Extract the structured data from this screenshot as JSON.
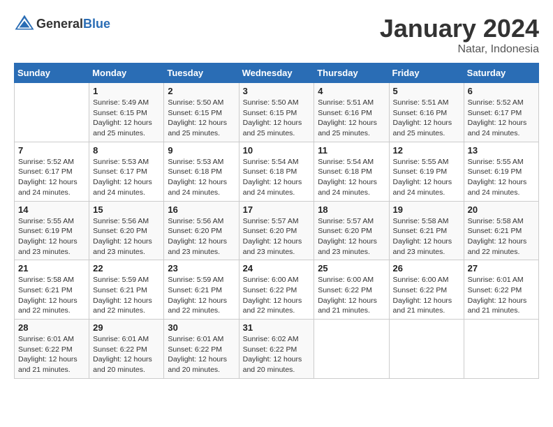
{
  "logo": {
    "text_general": "General",
    "text_blue": "Blue"
  },
  "title": "January 2024",
  "location": "Natar, Indonesia",
  "days_of_week": [
    "Sunday",
    "Monday",
    "Tuesday",
    "Wednesday",
    "Thursday",
    "Friday",
    "Saturday"
  ],
  "weeks": [
    [
      {
        "num": "",
        "info": ""
      },
      {
        "num": "1",
        "info": "Sunrise: 5:49 AM\nSunset: 6:15 PM\nDaylight: 12 hours\nand 25 minutes."
      },
      {
        "num": "2",
        "info": "Sunrise: 5:50 AM\nSunset: 6:15 PM\nDaylight: 12 hours\nand 25 minutes."
      },
      {
        "num": "3",
        "info": "Sunrise: 5:50 AM\nSunset: 6:15 PM\nDaylight: 12 hours\nand 25 minutes."
      },
      {
        "num": "4",
        "info": "Sunrise: 5:51 AM\nSunset: 6:16 PM\nDaylight: 12 hours\nand 25 minutes."
      },
      {
        "num": "5",
        "info": "Sunrise: 5:51 AM\nSunset: 6:16 PM\nDaylight: 12 hours\nand 25 minutes."
      },
      {
        "num": "6",
        "info": "Sunrise: 5:52 AM\nSunset: 6:17 PM\nDaylight: 12 hours\nand 24 minutes."
      }
    ],
    [
      {
        "num": "7",
        "info": "Sunrise: 5:52 AM\nSunset: 6:17 PM\nDaylight: 12 hours\nand 24 minutes."
      },
      {
        "num": "8",
        "info": "Sunrise: 5:53 AM\nSunset: 6:17 PM\nDaylight: 12 hours\nand 24 minutes."
      },
      {
        "num": "9",
        "info": "Sunrise: 5:53 AM\nSunset: 6:18 PM\nDaylight: 12 hours\nand 24 minutes."
      },
      {
        "num": "10",
        "info": "Sunrise: 5:54 AM\nSunset: 6:18 PM\nDaylight: 12 hours\nand 24 minutes."
      },
      {
        "num": "11",
        "info": "Sunrise: 5:54 AM\nSunset: 6:18 PM\nDaylight: 12 hours\nand 24 minutes."
      },
      {
        "num": "12",
        "info": "Sunrise: 5:55 AM\nSunset: 6:19 PM\nDaylight: 12 hours\nand 24 minutes."
      },
      {
        "num": "13",
        "info": "Sunrise: 5:55 AM\nSunset: 6:19 PM\nDaylight: 12 hours\nand 24 minutes."
      }
    ],
    [
      {
        "num": "14",
        "info": "Sunrise: 5:55 AM\nSunset: 6:19 PM\nDaylight: 12 hours\nand 23 minutes."
      },
      {
        "num": "15",
        "info": "Sunrise: 5:56 AM\nSunset: 6:20 PM\nDaylight: 12 hours\nand 23 minutes."
      },
      {
        "num": "16",
        "info": "Sunrise: 5:56 AM\nSunset: 6:20 PM\nDaylight: 12 hours\nand 23 minutes."
      },
      {
        "num": "17",
        "info": "Sunrise: 5:57 AM\nSunset: 6:20 PM\nDaylight: 12 hours\nand 23 minutes."
      },
      {
        "num": "18",
        "info": "Sunrise: 5:57 AM\nSunset: 6:20 PM\nDaylight: 12 hours\nand 23 minutes."
      },
      {
        "num": "19",
        "info": "Sunrise: 5:58 AM\nSunset: 6:21 PM\nDaylight: 12 hours\nand 23 minutes."
      },
      {
        "num": "20",
        "info": "Sunrise: 5:58 AM\nSunset: 6:21 PM\nDaylight: 12 hours\nand 22 minutes."
      }
    ],
    [
      {
        "num": "21",
        "info": "Sunrise: 5:58 AM\nSunset: 6:21 PM\nDaylight: 12 hours\nand 22 minutes."
      },
      {
        "num": "22",
        "info": "Sunrise: 5:59 AM\nSunset: 6:21 PM\nDaylight: 12 hours\nand 22 minutes."
      },
      {
        "num": "23",
        "info": "Sunrise: 5:59 AM\nSunset: 6:21 PM\nDaylight: 12 hours\nand 22 minutes."
      },
      {
        "num": "24",
        "info": "Sunrise: 6:00 AM\nSunset: 6:22 PM\nDaylight: 12 hours\nand 22 minutes."
      },
      {
        "num": "25",
        "info": "Sunrise: 6:00 AM\nSunset: 6:22 PM\nDaylight: 12 hours\nand 21 minutes."
      },
      {
        "num": "26",
        "info": "Sunrise: 6:00 AM\nSunset: 6:22 PM\nDaylight: 12 hours\nand 21 minutes."
      },
      {
        "num": "27",
        "info": "Sunrise: 6:01 AM\nSunset: 6:22 PM\nDaylight: 12 hours\nand 21 minutes."
      }
    ],
    [
      {
        "num": "28",
        "info": "Sunrise: 6:01 AM\nSunset: 6:22 PM\nDaylight: 12 hours\nand 21 minutes."
      },
      {
        "num": "29",
        "info": "Sunrise: 6:01 AM\nSunset: 6:22 PM\nDaylight: 12 hours\nand 20 minutes."
      },
      {
        "num": "30",
        "info": "Sunrise: 6:01 AM\nSunset: 6:22 PM\nDaylight: 12 hours\nand 20 minutes."
      },
      {
        "num": "31",
        "info": "Sunrise: 6:02 AM\nSunset: 6:22 PM\nDaylight: 12 hours\nand 20 minutes."
      },
      {
        "num": "",
        "info": ""
      },
      {
        "num": "",
        "info": ""
      },
      {
        "num": "",
        "info": ""
      }
    ]
  ]
}
